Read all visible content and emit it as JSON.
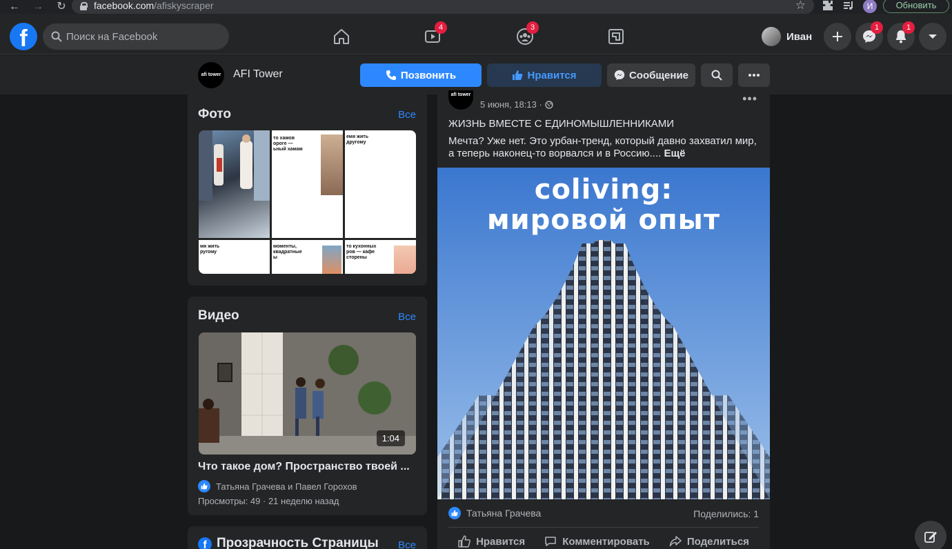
{
  "browser": {
    "url_domain": "facebook.com",
    "url_path": "/afiskyscraper",
    "profile_initial": "И",
    "update_label": "Обновить"
  },
  "topbar": {
    "search_placeholder": "Поиск на Facebook",
    "watch_badge": "4",
    "groups_badge": "3",
    "user_name": "Иван",
    "messenger_badge": "1",
    "notifications_badge": "1"
  },
  "page": {
    "avatar_text": "afi tower",
    "name": "AFI Tower",
    "call_label": "Позвонить",
    "like_label": "Нравится",
    "message_label": "Сообщение"
  },
  "photos_card": {
    "title": "Фото",
    "see_all": "Все",
    "tiles": [
      "",
      "то хамов\nороге —\nьный хамам",
      "емя жить\nдругому",
      "мя жить\nругому",
      "моменты,\nквадратные\nы",
      "то кухонных\nров — кафе\nсторены"
    ]
  },
  "video_card": {
    "title": "Видео",
    "see_all": "Все",
    "duration": "1:04",
    "video_title": "Что такое дом? Пространство твоей ...",
    "likers": "Татьяна Грачева и Павел Горохов",
    "views": "Просмотры: 49 · 21 неделю назад"
  },
  "transparency_card": {
    "title": "Прозрачность Страницы",
    "see_all": "Все"
  },
  "post": {
    "avatar_text": "afi tower",
    "date": "5 июня, 18:13 ·",
    "title": "ЖИЗНЬ ВМЕСТЕ С ЕДИНОМЫШЛЕННИКАМИ",
    "text": "Мечта? Уже нет. Это урбан-тренд, который давно захватил мир, а теперь наконец-то ворвался и в Россию.... ",
    "more": "Ещё",
    "image_line1": "coliving:",
    "image_line2": "мировой опыт",
    "reactor": "Татьяна Грачева",
    "shares": "Поделились: 1",
    "like": "Нравится",
    "comment": "Комментировать",
    "share": "Поделиться"
  },
  "colors": {
    "background": "#18191a",
    "surface": "#242526",
    "accent": "#2d88ff",
    "badge": "#e41e3f"
  },
  "icons": [
    "fb-logo",
    "search-icon",
    "home-icon",
    "watch-icon",
    "groups-icon",
    "gaming-icon",
    "plus-icon",
    "messenger-icon",
    "bell-icon",
    "caret-down-icon",
    "phone-icon",
    "thumbs-up-icon",
    "more-icon",
    "globe-icon",
    "comment-icon",
    "share-icon",
    "compose-icon"
  ]
}
